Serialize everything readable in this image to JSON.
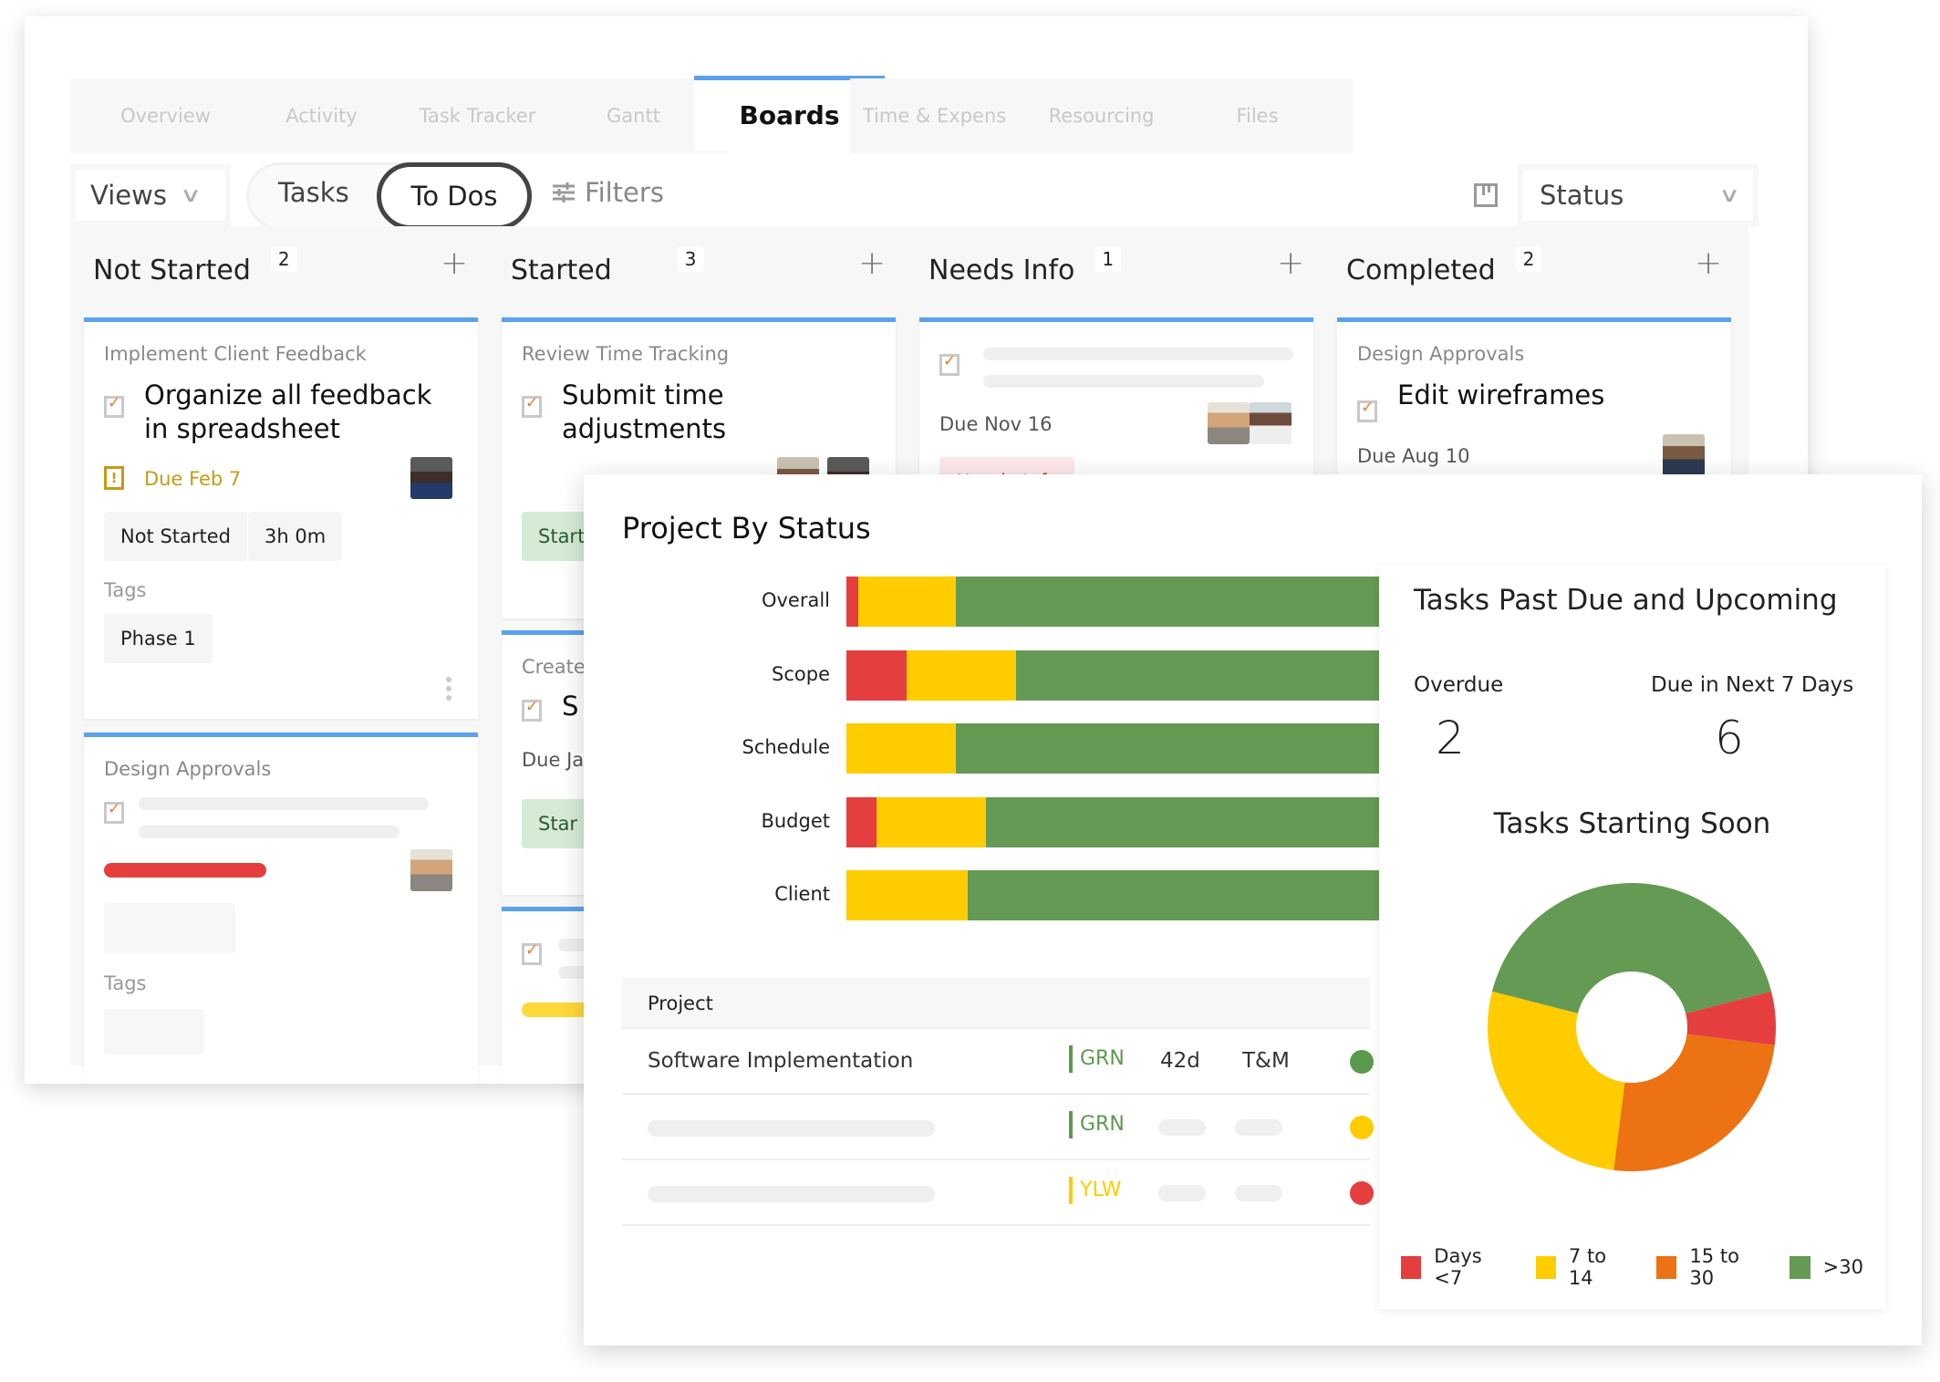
{
  "nav": {
    "tabs": [
      {
        "label": "Overview",
        "active": false
      },
      {
        "label": "Activity",
        "active": false
      },
      {
        "label": "Task Tracker",
        "active": false
      },
      {
        "label": "Gantt",
        "active": false
      },
      {
        "label": "Boards",
        "active": true
      },
      {
        "label": "Time & Expenses",
        "active": false
      },
      {
        "label": "Resourcing",
        "active": false
      },
      {
        "label": "Files",
        "active": false
      }
    ]
  },
  "toolbar": {
    "views_label": "Views",
    "tasks_label": "Tasks",
    "todos_label": "To Dos",
    "filters_label": "Filters",
    "group_by_value": "Status",
    "chevron_icon": "chevron-down-icon",
    "filters_icon": "sliders-icon",
    "board_icon": "kanban-board-icon"
  },
  "columns": [
    {
      "title": "Not Started",
      "count": "2"
    },
    {
      "title": "Started",
      "count": "3"
    },
    {
      "title": "Needs Info",
      "count": "1"
    },
    {
      "title": "Completed",
      "count": "2"
    }
  ],
  "cards": {
    "ns1": {
      "parent": "Implement Client Feedback",
      "title": "Organize all feedback in spreadsheet",
      "due": "Due Feb 7",
      "status": "Not Started",
      "time": "3h 0m",
      "tags_label": "Tags",
      "tag": "Phase 1"
    },
    "ns2": {
      "parent": "Design Approvals",
      "tags_label": "Tags",
      "progress_color": "#e53e3e"
    },
    "st1": {
      "parent": "Review Time Tracking",
      "title": "Submit time adjustments",
      "status": "Started"
    },
    "st2": {
      "parent": "Create",
      "title": "S",
      "due": "Due Ja",
      "status": "Star"
    },
    "ni1": {
      "due": "Due Nov 16",
      "status": "Needs Info"
    },
    "co1": {
      "parent": "Design Approvals",
      "title": "Edit wireframes",
      "due": "Due Aug 10"
    }
  },
  "dashboard": {
    "title": "Project By Status",
    "table": {
      "header": "Project",
      "rows": [
        {
          "name": "Software Implementation",
          "code": "GRN",
          "code_color": "#5b9a4e",
          "days": "42d",
          "type": "T&M",
          "dot_color": "#5b9a4e"
        },
        {
          "name": "",
          "code": "GRN",
          "code_color": "#5b9a4e",
          "days": "",
          "type": "",
          "dot_color": "#ffcc00"
        },
        {
          "name": "",
          "code": "YLW",
          "code_color": "#ffcc00",
          "days": "",
          "type": "",
          "dot_color": "#e53e3e"
        }
      ]
    },
    "tasks_panel": {
      "title": "Tasks Past Due and Upcoming",
      "overdue_label": "Overdue",
      "overdue_value": "2",
      "upcoming_label": "Due in Next 7 Days",
      "upcoming_value": "6",
      "starting_soon_title": "Tasks Starting Soon"
    }
  },
  "chart_data": [
    {
      "type": "bar",
      "orientation": "horizontal-stacked-100",
      "title": "Project By Status",
      "categories": [
        "Overall",
        "Scope",
        "Schedule",
        "Budget",
        "Client"
      ],
      "series": [
        {
          "name": "Red",
          "color": "#e53e3e",
          "values": [
            2,
            10,
            0,
            5,
            0
          ]
        },
        {
          "name": "Yellow",
          "color": "#ffcc00",
          "values": [
            16,
            18,
            18,
            18,
            20
          ]
        },
        {
          "name": "Green",
          "color": "#649a54",
          "values": [
            82,
            72,
            82,
            77,
            80
          ]
        }
      ],
      "xlim": [
        0,
        100
      ],
      "grid": false
    },
    {
      "type": "pie",
      "donut": true,
      "title": "Tasks Starting Soon",
      "labels": [
        "Days <7",
        "7 to 14",
        "15 to 30",
        ">30"
      ],
      "values": [
        6,
        27,
        25,
        42
      ],
      "colors": [
        "#e53e3e",
        "#ffcc00",
        "#ec7214",
        "#649a54"
      ],
      "legend": "bottom"
    }
  ]
}
